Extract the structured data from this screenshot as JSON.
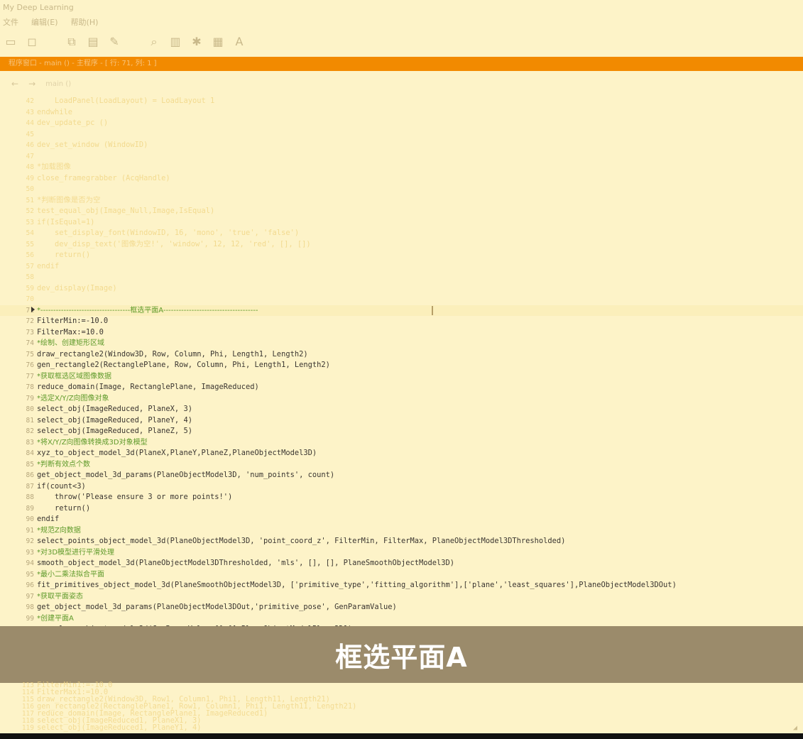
{
  "window": {
    "title": "My Deep Learning"
  },
  "menubar": {
    "items": [
      "文件",
      "编辑(E)",
      "帮助(H)"
    ]
  },
  "toolbar": {
    "icons": [
      "rect-icon",
      "select-icon",
      "copy-icon",
      "paste-icon",
      "tool-icon",
      "zoom-icon",
      "chart-icon",
      "settings-icon",
      "grid-icon",
      "text-icon"
    ]
  },
  "orange_bar": {
    "text": "程序窗口 - main () - 主程序 - [ 行: 71, 列: 1 ]"
  },
  "editor_toolbar": {
    "back": "←",
    "forward": "→",
    "procedure": "main ()"
  },
  "code": {
    "blurred_top": [
      {
        "n": "42",
        "t": "    LoadPanel(LoadLayout) = LoadLayout 1"
      },
      {
        "n": "43",
        "t": "endwhile"
      },
      {
        "n": "44",
        "t": "dev_update_pc ()"
      },
      {
        "n": "45",
        "t": ""
      },
      {
        "n": "46",
        "t": "dev_set_window (WindowID)"
      },
      {
        "n": "47",
        "t": ""
      },
      {
        "n": "48",
        "t": "*加载图像"
      },
      {
        "n": "49",
        "t": "close_framegrabber (AcqHandle)"
      },
      {
        "n": "50",
        "t": ""
      },
      {
        "n": "51",
        "t": "*判断图像是否为空"
      },
      {
        "n": "52",
        "t": "test_equal_obj(Image_Null,Image,IsEqual)"
      },
      {
        "n": "53",
        "t": "if(IsEqual=1)"
      },
      {
        "n": "54",
        "t": "    set_display_font(WindowID, 16, 'mono', 'true', 'false')"
      },
      {
        "n": "55",
        "t": "    dev_disp_text('图像为空!', 'window', 12, 12, 'red', [], [])"
      },
      {
        "n": "56",
        "t": "    return()"
      },
      {
        "n": "57",
        "t": "endif"
      },
      {
        "n": "58",
        "t": ""
      },
      {
        "n": "59",
        "t": "dev_display(Image)"
      },
      {
        "n": "70",
        "t": ""
      }
    ],
    "marker_line": {
      "n": "71",
      "t": "*-----------------------------------框选平面A-------------------------------------"
    },
    "lines": [
      {
        "n": "72",
        "t": "FilterMin:=-10.0",
        "kind": "code"
      },
      {
        "n": "73",
        "t": "FilterMax:=10.0",
        "kind": "code"
      },
      {
        "n": "74",
        "t": "*绘制、创建矩形区域",
        "kind": "comment"
      },
      {
        "n": "75",
        "t": "draw_rectangle2(Window3D, Row, Column, Phi, Length1, Length2)",
        "kind": "code"
      },
      {
        "n": "76",
        "t": "gen_rectangle2(RectanglePlane, Row, Column, Phi, Length1, Length2)",
        "kind": "code"
      },
      {
        "n": "77",
        "t": "*获取框选区域图像数据",
        "kind": "comment"
      },
      {
        "n": "78",
        "t": "reduce_domain(Image, RectanglePlane, ImageReduced)",
        "kind": "code"
      },
      {
        "n": "79",
        "t": "*选定X/Y/Z向图像对象",
        "kind": "comment"
      },
      {
        "n": "80",
        "t": "select_obj(ImageReduced, PlaneX, 3)",
        "kind": "code"
      },
      {
        "n": "81",
        "t": "select_obj(ImageReduced, PlaneY, 4)",
        "kind": "code"
      },
      {
        "n": "82",
        "t": "select_obj(ImageReduced, PlaneZ, 5)",
        "kind": "code"
      },
      {
        "n": "83",
        "t": "*将X/Y/Z向图像转换成3D对象模型",
        "kind": "comment"
      },
      {
        "n": "84",
        "t": "xyz_to_object_model_3d(PlaneX,PlaneY,PlaneZ,PlaneObjectModel3D)",
        "kind": "code"
      },
      {
        "n": "85",
        "t": "*判断有效点个数",
        "kind": "comment"
      },
      {
        "n": "86",
        "t": "get_object_model_3d_params(PlaneObjectModel3D, 'num_points', count)",
        "kind": "code"
      },
      {
        "n": "87",
        "t": "if(count<3)",
        "kind": "code"
      },
      {
        "n": "88",
        "t": "    throw('Please ensure 3 or more points!')",
        "kind": "code"
      },
      {
        "n": "89",
        "t": "    return()",
        "kind": "code"
      },
      {
        "n": "90",
        "t": "endif",
        "kind": "code"
      },
      {
        "n": "91",
        "t": "*规范Z向数据",
        "kind": "comment"
      },
      {
        "n": "92",
        "t": "select_points_object_model_3d(PlaneObjectModel3D, 'point_coord_z', FilterMin, FilterMax, PlaneObjectModel3DThresholded)",
        "kind": "code"
      },
      {
        "n": "93",
        "t": "*对3D模型进行平滑处理",
        "kind": "comment"
      },
      {
        "n": "94",
        "t": "smooth_object_model_3d(PlaneObjectModel3DThresholded, 'mls', [], [], PlaneSmoothObjectModel3D)",
        "kind": "code"
      },
      {
        "n": "95",
        "t": "*最小二乘法拟合平面",
        "kind": "comment"
      },
      {
        "n": "96",
        "t": "fit_primitives_object_model_3d(PlaneSmoothObjectModel3D, ['primitive_type','fitting_algorithm'],['plane','least_squares'],PlaneObjectModel3DOut)",
        "kind": "code"
      },
      {
        "n": "97",
        "t": "*获取平面姿态",
        "kind": "comment"
      },
      {
        "n": "98",
        "t": "get_object_model_3d_params(PlaneObjectModel3DOut,'primitive_pose', GenParamValue)",
        "kind": "code"
      },
      {
        "n": "99",
        "t": "*创建平面A",
        "kind": "comment"
      },
      {
        "n": "100",
        "t": "gen_plane_object_model_3d(GenParamValue,[],[],PlaneObjectModelPlane3D1)",
        "kind": "code"
      },
      {
        "n": "101",
        "t": "",
        "kind": "code"
      }
    ],
    "blurred_bottom": [
      {
        "n": "113",
        "t": "FilterMin1:=-10.0"
      },
      {
        "n": "114",
        "t": "FilterMax1:=10.0"
      },
      {
        "n": "115",
        "t": "draw_rectangle2(Window3D, Row1, Column1, Phi1, Length11, Length21)"
      },
      {
        "n": "116",
        "t": "gen_rectangle2(RectanglePlane1, Row1, Column1, Phi1, Length11, Length21)"
      },
      {
        "n": "117",
        "t": "reduce_domain(Image, RectanglePlane1, ImageReduced1)"
      },
      {
        "n": "118",
        "t": "select_obj(ImageReduced1, PlaneX1, 3)"
      },
      {
        "n": "119",
        "t": "select_obj(ImageReduced1, PlaneY1, 4)"
      }
    ]
  },
  "caption": {
    "text": "框选平面A"
  }
}
